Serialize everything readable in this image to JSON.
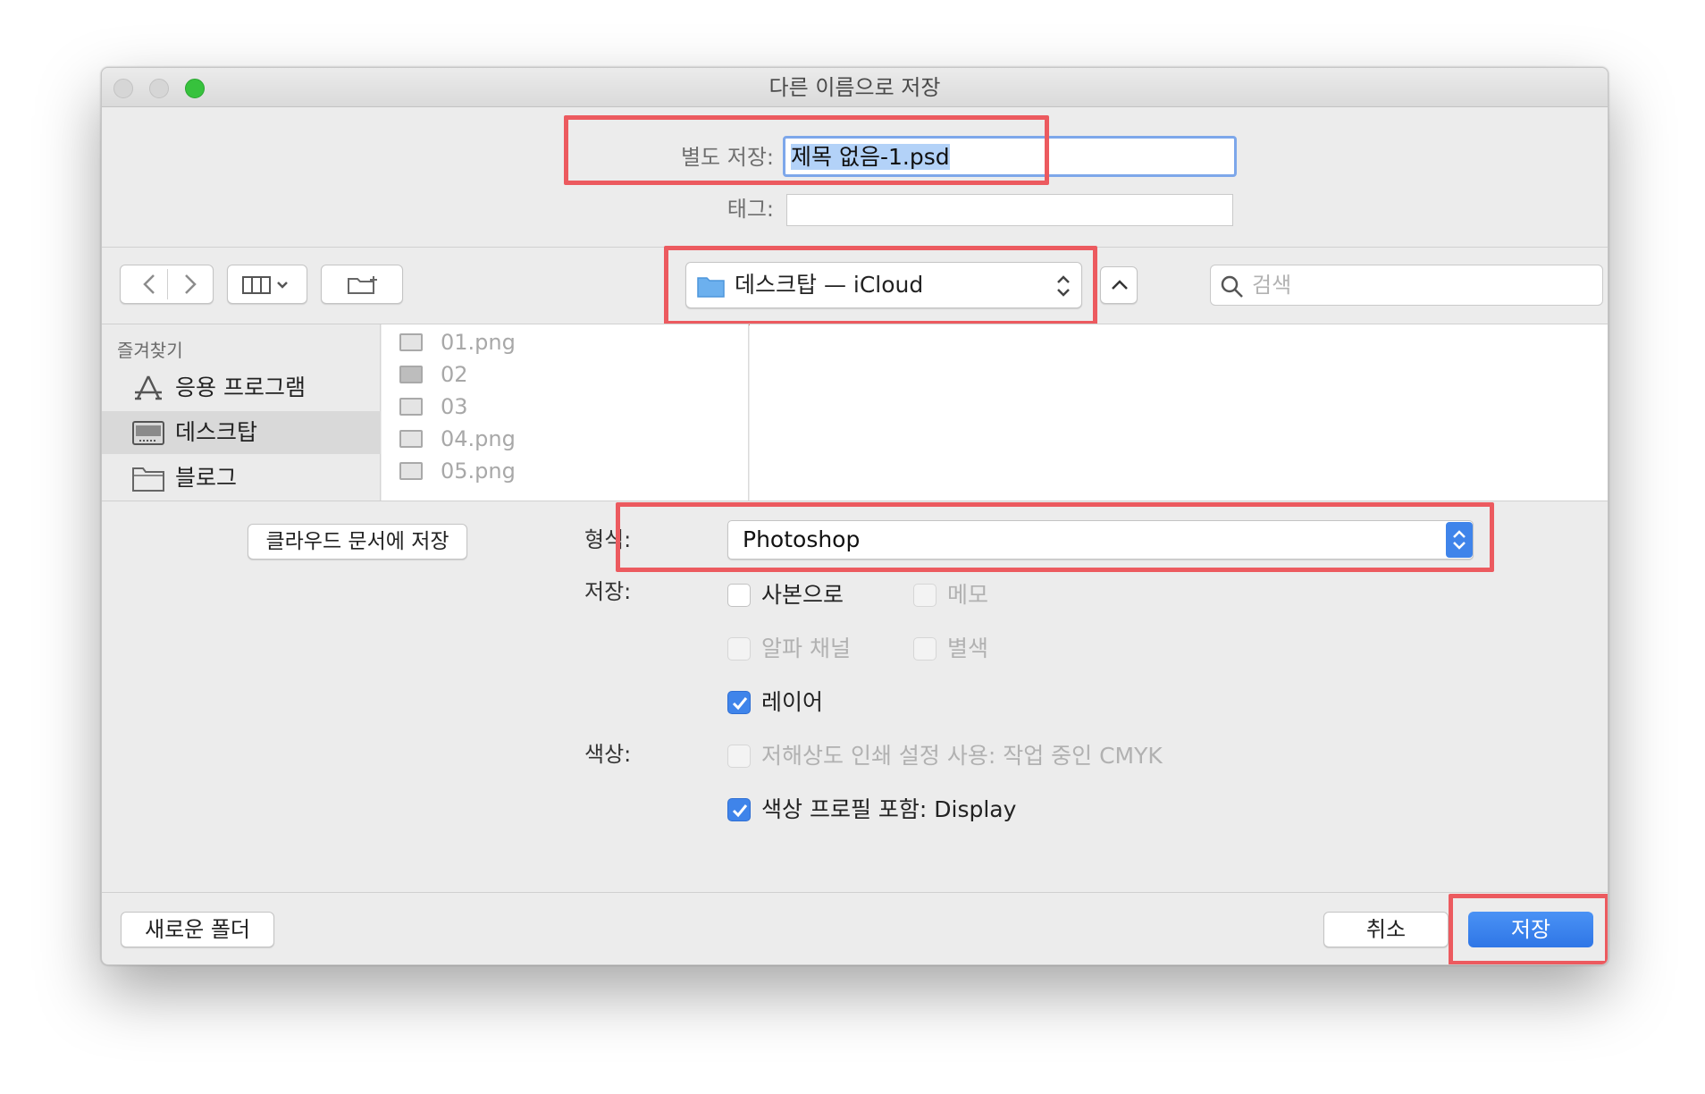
{
  "window": {
    "title": "다른 이름으로 저장"
  },
  "save_as": {
    "label": "별도 저장:",
    "value": "제목 없음-1.psd"
  },
  "tags": {
    "label": "태그:"
  },
  "toolbar": {
    "location": "데스크탑 — iCloud",
    "search_placeholder": "검색"
  },
  "sidebar": {
    "section": "즐겨찾기",
    "items": [
      {
        "label": "응용 프로그램",
        "icon": "app-store-icon"
      },
      {
        "label": "데스크탑",
        "icon": "desktop-icon",
        "selected": true
      },
      {
        "label": "블로그",
        "icon": "folder-icon"
      }
    ]
  },
  "files": [
    "01.png",
    "02",
    "03",
    "04.png",
    "05.png"
  ],
  "options": {
    "cloud_button": "클라우드 문서에 저장",
    "format_label": "형식:",
    "format_value": "Photoshop",
    "save_label": "저장:",
    "color_label": "색상:",
    "checkbox_copy": "사본으로",
    "checkbox_notes": "메모",
    "checkbox_alpha": "알파 채널",
    "checkbox_spot": "별색",
    "checkbox_layers": "레이어",
    "checkbox_proof": "저해상도 인쇄 설정 사용: 작업 중인 CMYK",
    "checkbox_profile": "색상 프로필 포함: Display"
  },
  "footer": {
    "new_folder": "새로운 폴더",
    "cancel": "취소",
    "save": "저장"
  },
  "colors": {
    "accent": "#3f84ea",
    "highlight": "#ec5a5f"
  }
}
